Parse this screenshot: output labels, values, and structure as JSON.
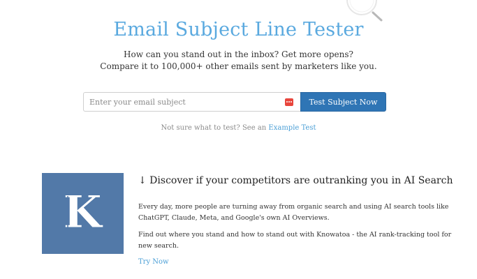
{
  "hero": {
    "title": "Email Subject Line Tester",
    "subtitle_line1": "How can you stand out in the inbox? Get more opens?",
    "subtitle_line2": "Compare it to 100,000+ other emails sent by marketers like you."
  },
  "form": {
    "placeholder": "Enter your email subject",
    "value": "",
    "submit_label": "Test Subject Now"
  },
  "example": {
    "prefix": "Not sure what to test? See an",
    "link_label": "Example Test"
  },
  "promo": {
    "logo_letter": "K",
    "heading": "↓ Discover if your competitors are outranking you in AI Search",
    "paragraph1": "Every day, more people are turning away from organic search and using AI search tools like ChatGPT, Claude, Meta, and Google's own AI Overviews.",
    "paragraph2": "Find out where you stand and how to stand out with Knowatoa - the AI rank-tracking tool for new search.",
    "cta_label": "Try Now"
  },
  "colors": {
    "title": "#5aa9df",
    "button": "#2f75b5",
    "link": "#4b9fd6",
    "logo_bg": "#5279a8",
    "input_icon": "#e8453c"
  },
  "icons": {
    "decor": "magnifier-icon",
    "input": "password-dots-icon"
  }
}
